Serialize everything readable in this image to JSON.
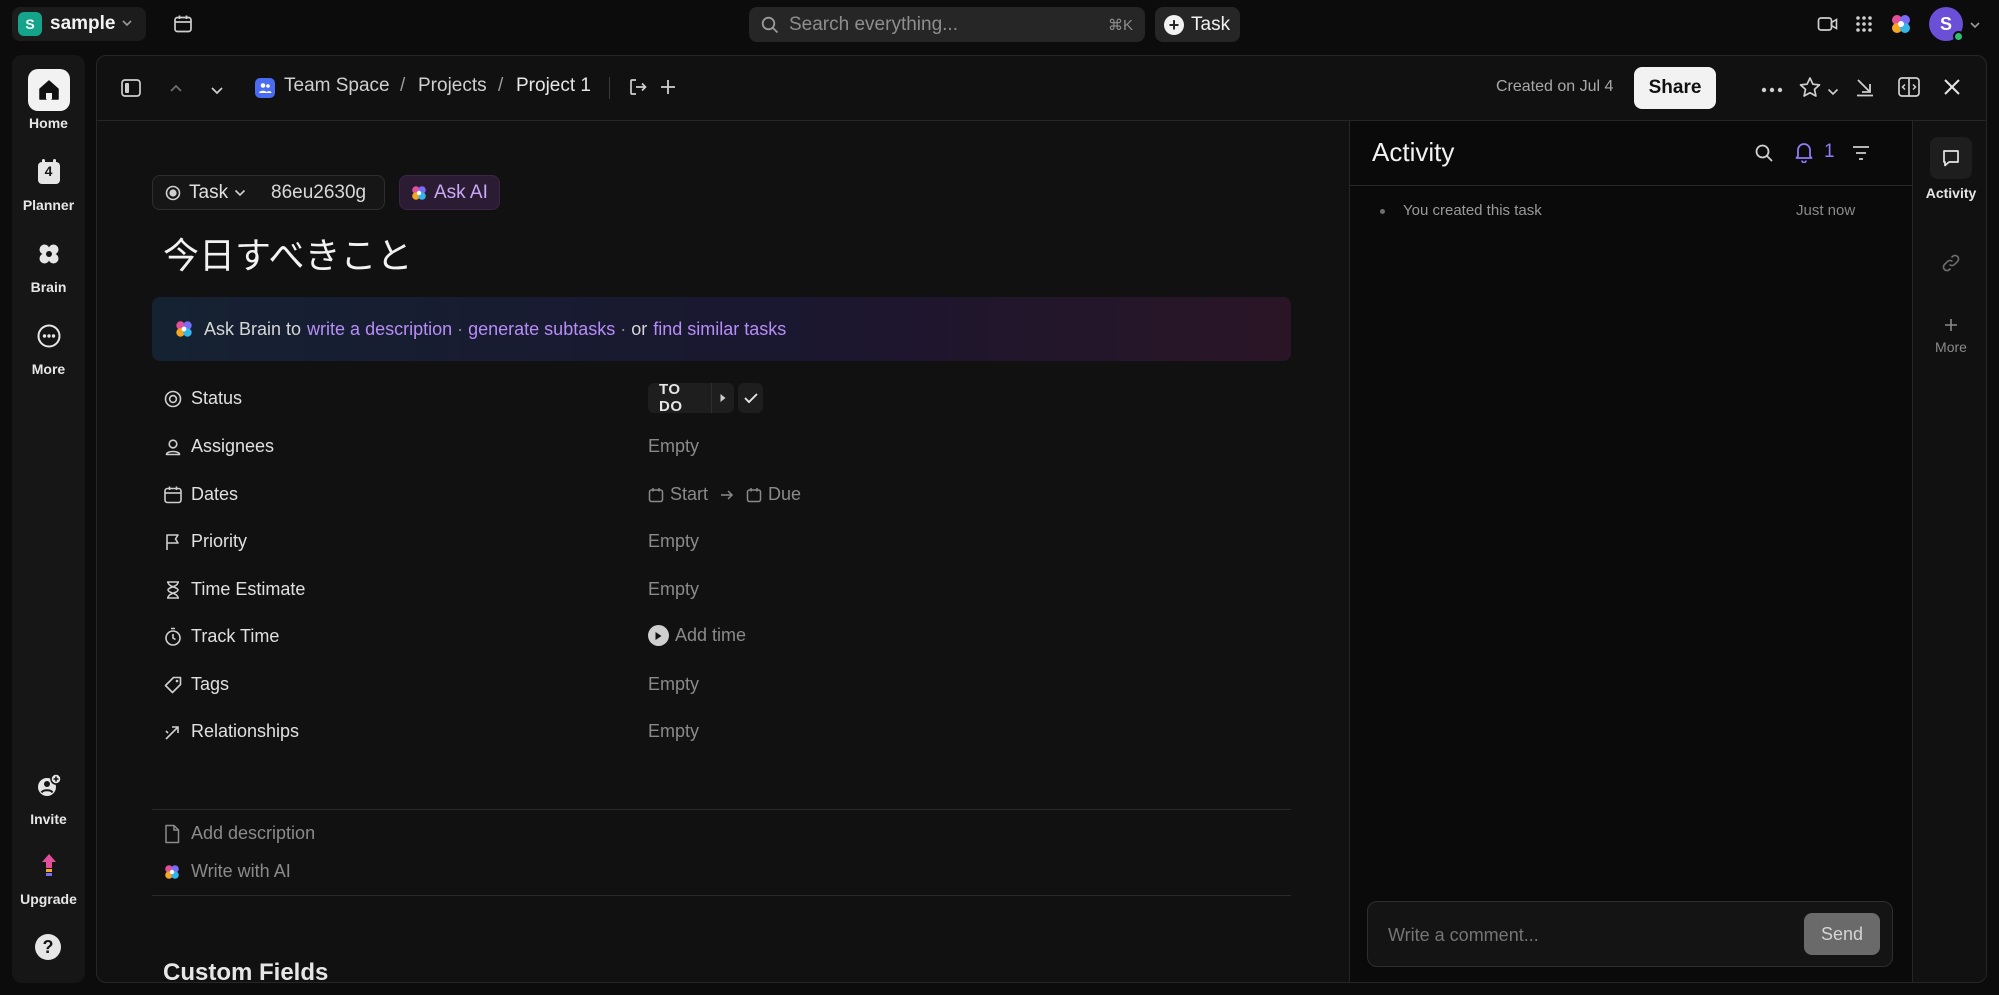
{
  "workspace": {
    "initial": "S",
    "name": "sample"
  },
  "search": {
    "placeholder": "Search everything...",
    "shortcut": "⌘K"
  },
  "topbar": {
    "task_button": "Task",
    "avatar_initial": "S"
  },
  "nav": {
    "home": "Home",
    "planner": "Planner",
    "planner_badge": "4",
    "brain": "Brain",
    "more": "More",
    "invite": "Invite",
    "upgrade": "Upgrade",
    "help": "?"
  },
  "breadcrumb": {
    "space": "Team Space",
    "folder": "Projects",
    "list": "Project 1",
    "sep": "/"
  },
  "header": {
    "created": "Created on Jul 4",
    "share": "Share"
  },
  "task": {
    "type": "Task",
    "id": "86eu2630g",
    "ask_ai": "Ask AI",
    "title": "今日すべきこと"
  },
  "brain_bar": {
    "prefix": "Ask Brain to",
    "link1": "write a description",
    "link2": "generate subtasks",
    "or": "or",
    "link3": "find similar tasks",
    "dot": "·"
  },
  "properties": {
    "status": {
      "label": "Status",
      "value": "TO DO"
    },
    "assignees": {
      "label": "Assignees",
      "value": "Empty"
    },
    "dates": {
      "label": "Dates",
      "start": "Start",
      "due": "Due"
    },
    "priority": {
      "label": "Priority",
      "value": "Empty"
    },
    "time_estimate": {
      "label": "Time Estimate",
      "value": "Empty"
    },
    "track_time": {
      "label": "Track Time",
      "value": "Add time"
    },
    "tags": {
      "label": "Tags",
      "value": "Empty"
    },
    "relationships": {
      "label": "Relationships",
      "value": "Empty"
    }
  },
  "description": {
    "add": "Add description",
    "write_ai": "Write with AI"
  },
  "custom_fields": {
    "title": "Custom Fields"
  },
  "activity": {
    "title": "Activity",
    "notifications": "1",
    "entries": [
      {
        "text": "You created this task",
        "time": "Just now"
      }
    ],
    "comment_placeholder": "Write a comment...",
    "send": "Send"
  },
  "rail": {
    "activity": "Activity",
    "more": "More"
  }
}
